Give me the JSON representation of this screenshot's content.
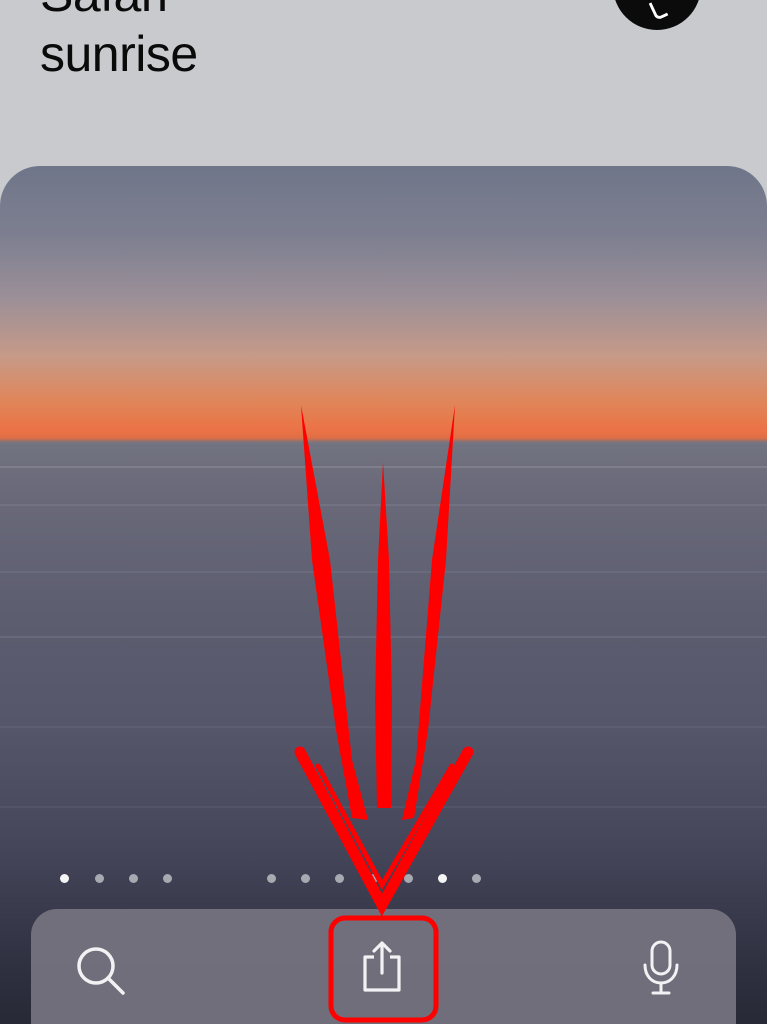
{
  "header": {
    "title_line1": "Safari-",
    "title_line2": "sunrise"
  },
  "header_button": {
    "icon": "pen-icon"
  },
  "wallpaper": {
    "description_colors": {
      "sky_top": "#6f7689",
      "horizon": "#e87546",
      "water": "#5d5e70"
    }
  },
  "page_indicator": {
    "count": 14,
    "active_indices": [
      0,
      12
    ]
  },
  "toolbar": {
    "search_icon": "search-icon",
    "share_icon": "share-icon",
    "mic_icon": "microphone-icon"
  },
  "annotation": {
    "color": "#ff0000",
    "highlight_target": "share-button"
  }
}
